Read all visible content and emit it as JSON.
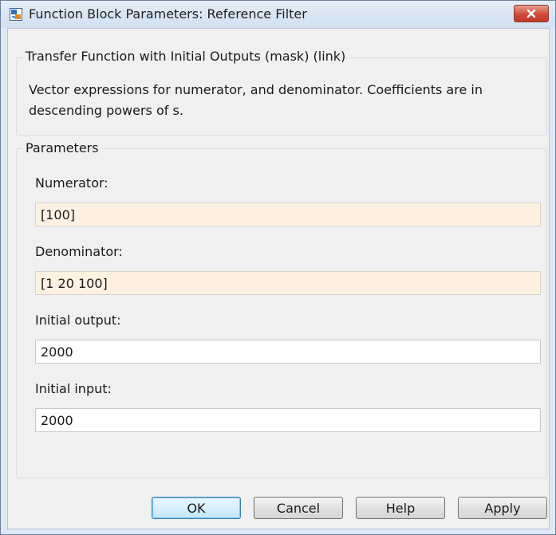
{
  "window": {
    "title": "Function Block Parameters: Reference Filter",
    "close_icon": "close-icon"
  },
  "mask": {
    "group_label": "Transfer Function with Initial Outputs (mask) (link)",
    "description": "Vector expressions for numerator, and denominator. Coefficients are in descending powers of s."
  },
  "parameters": {
    "group_label": "Parameters",
    "fields": [
      {
        "label": "Numerator:",
        "value": "[100]"
      },
      {
        "label": "Denominator:",
        "value": "[1 20 100]"
      },
      {
        "label": "Initial output:",
        "value": "2000"
      },
      {
        "label": "Initial input:",
        "value": "2000"
      }
    ]
  },
  "buttons": {
    "ok": "OK",
    "cancel": "Cancel",
    "help": "Help",
    "apply": "Apply"
  },
  "colors": {
    "tunable_field_bg": "#fdf2e2",
    "plain_field_bg": "#ffffff",
    "close_button": "#c94431"
  }
}
